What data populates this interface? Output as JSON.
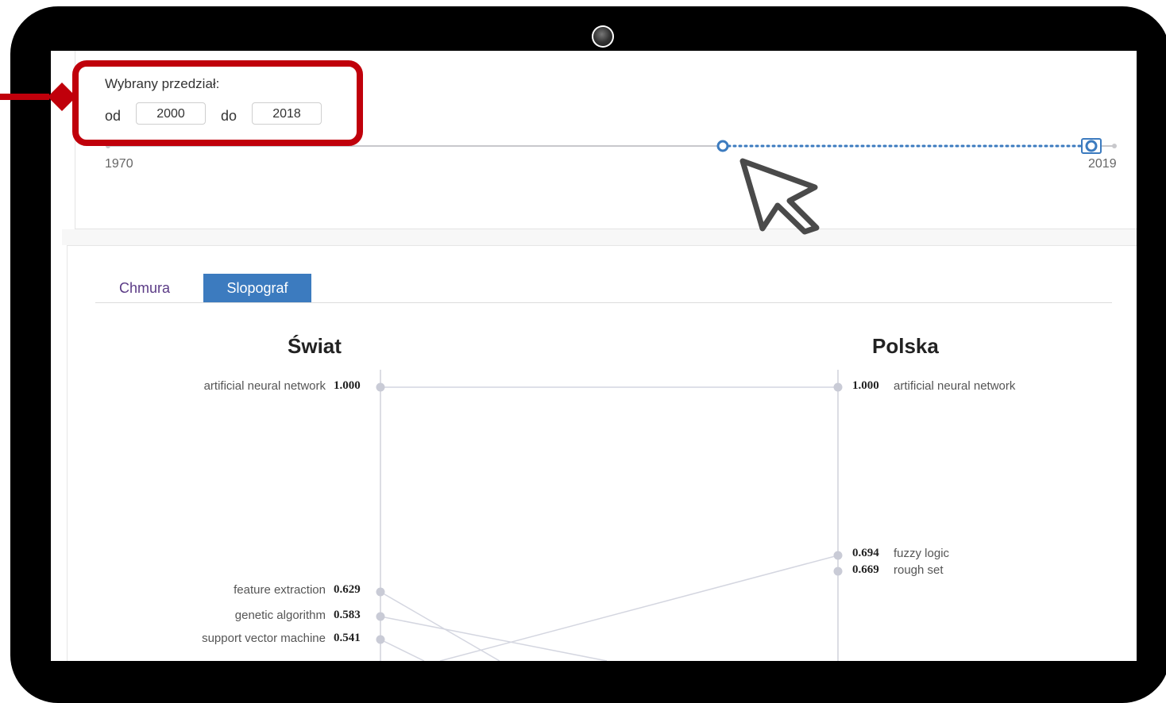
{
  "range": {
    "label": "Wybrany przedział:",
    "from_label": "od",
    "from_value": "2000",
    "to_label": "do",
    "to_value": "2018",
    "slider_min_label": "1970",
    "slider_max_label": "2019",
    "slider_min": 1970,
    "slider_max": 2019,
    "selected_from": 2000,
    "selected_to": 2018
  },
  "tabs": [
    {
      "label": "Chmura",
      "active": false
    },
    {
      "label": "Slopograf",
      "active": true
    }
  ],
  "slopegraph": {
    "left_title": "Świat",
    "right_title": "Polska",
    "left": [
      {
        "term": "artificial neural network",
        "value": "1.000"
      },
      {
        "term": "feature extraction",
        "value": "0.629"
      },
      {
        "term": "genetic algorithm",
        "value": "0.583"
      },
      {
        "term": "support vector machine",
        "value": "0.541"
      }
    ],
    "right": [
      {
        "term": "artificial neural network",
        "value": "1.000"
      },
      {
        "term": "fuzzy logic",
        "value": "0.694"
      },
      {
        "term": "rough set",
        "value": "0.669"
      }
    ]
  },
  "colors": {
    "accent": "#3c7bbf",
    "highlight": "#c0000b",
    "frame": "#000000",
    "tab_inactive_text": "#5b3b86",
    "slope_line": "#d4d6e0"
  },
  "icons": [
    "camera-icon",
    "cursor-icon",
    "arrow-pointer-icon"
  ]
}
